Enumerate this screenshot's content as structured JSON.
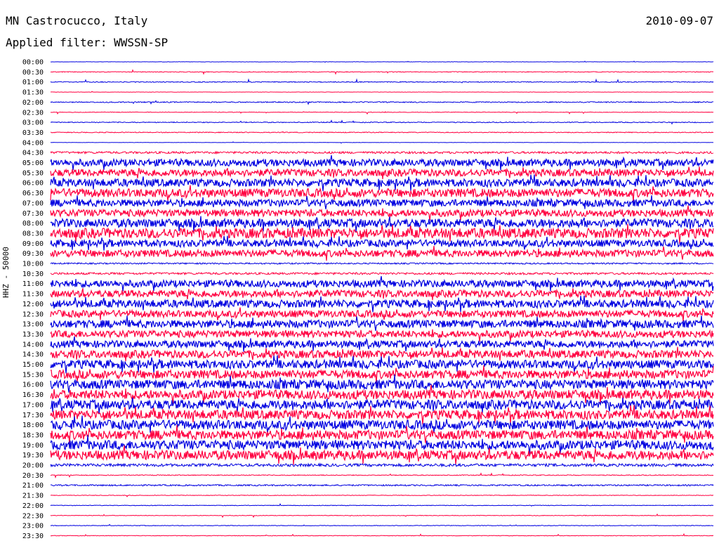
{
  "header": {
    "station": "MN Castrocucco, Italy",
    "filter": "Applied filter: WWSSN-SP",
    "date": "2010-09-07"
  },
  "chart_data": {
    "type": "line",
    "title": "MN Castrocucco, Italy",
    "subtitle": "Applied filter: WWSSN-SP",
    "ylabel": "HHZ - 50000",
    "colors": [
      "#0000e0",
      "#ff0040"
    ],
    "rows": [
      {
        "time": "00:00",
        "amp": 0.2
      },
      {
        "time": "00:30",
        "amp": 0.5
      },
      {
        "time": "01:00",
        "amp": 0.6
      },
      {
        "time": "01:30",
        "amp": 0.2
      },
      {
        "time": "02:00",
        "amp": 0.7
      },
      {
        "time": "02:30",
        "amp": 0.4
      },
      {
        "time": "03:00",
        "amp": 0.6
      },
      {
        "time": "03:30",
        "amp": 0.6
      },
      {
        "time": "04:00",
        "amp": 0.2
      },
      {
        "time": "04:30",
        "amp": 1.5
      },
      {
        "time": "05:00",
        "amp": 5
      },
      {
        "time": "05:30",
        "amp": 5
      },
      {
        "time": "06:00",
        "amp": 5.5
      },
      {
        "time": "06:30",
        "amp": 6
      },
      {
        "time": "07:00",
        "amp": 5
      },
      {
        "time": "07:30",
        "amp": 5
      },
      {
        "time": "08:00",
        "amp": 6
      },
      {
        "time": "08:30",
        "amp": 7
      },
      {
        "time": "09:00",
        "amp": 5
      },
      {
        "time": "09:30",
        "amp": 5
      },
      {
        "time": "10:00",
        "amp": 1
      },
      {
        "time": "10:30",
        "amp": 1.5
      },
      {
        "time": "11:00",
        "amp": 5
      },
      {
        "time": "11:30",
        "amp": 5
      },
      {
        "time": "12:00",
        "amp": 5.5
      },
      {
        "time": "12:30",
        "amp": 5
      },
      {
        "time": "13:00",
        "amp": 5.5
      },
      {
        "time": "13:30",
        "amp": 5
      },
      {
        "time": "14:00",
        "amp": 5
      },
      {
        "time": "14:30",
        "amp": 5.5
      },
      {
        "time": "15:00",
        "amp": 6
      },
      {
        "time": "15:30",
        "amp": 6
      },
      {
        "time": "16:00",
        "amp": 6.5
      },
      {
        "time": "16:30",
        "amp": 6.5
      },
      {
        "time": "17:00",
        "amp": 6.5
      },
      {
        "time": "17:30",
        "amp": 6.5
      },
      {
        "time": "18:00",
        "amp": 6.5
      },
      {
        "time": "18:30",
        "amp": 6.5
      },
      {
        "time": "19:00",
        "amp": 6.5
      },
      {
        "time": "19:30",
        "amp": 6.5
      },
      {
        "time": "20:00",
        "amp": 2
      },
      {
        "time": "20:30",
        "amp": 0.6
      },
      {
        "time": "21:00",
        "amp": 1
      },
      {
        "time": "21:30",
        "amp": 0.4
      },
      {
        "time": "22:00",
        "amp": 0.4
      },
      {
        "time": "22:30",
        "amp": 0.4
      },
      {
        "time": "23:00",
        "amp": 0.4
      },
      {
        "time": "23:30",
        "amp": 0.4
      }
    ]
  }
}
